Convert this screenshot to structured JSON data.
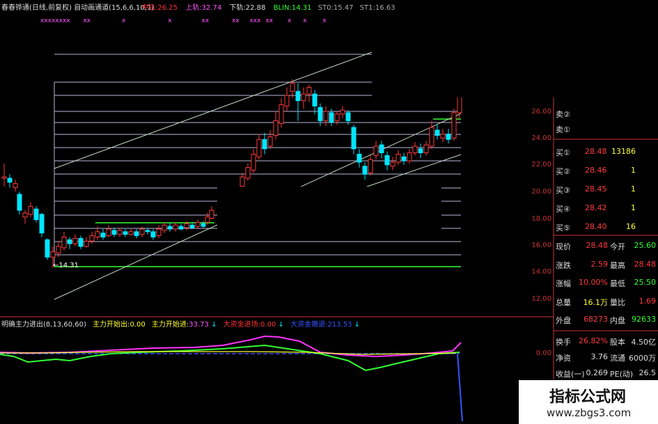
{
  "header": {
    "title": "春春铧通(日线,前复权)",
    "indicator": "自动画通道(15,6,6,10,1)",
    "mid_label": "中轨:",
    "mid_value": "26.25",
    "upper_label": "上轨:",
    "upper_value": "32.74",
    "lower_label": "下轨:",
    "lower_value": "22.88",
    "blin_label": "BLIN:",
    "blin_value": "14.31",
    "st0_label": "ST0:",
    "st0_value": "15.47",
    "st1_label": "ST1:",
    "st1_value": "16.63"
  },
  "marker_x": "x",
  "marker_xs": "xx",
  "marker_xxx": "xxx",
  "marker_row": "xxxxxxxx",
  "low_label": "←14.31",
  "sub": {
    "title": "明确主力进出(8,13,60,60)",
    "l1_label": "主力开始出:",
    "l1_value": "0.00",
    "l2_label": "主力开始进:",
    "l2_value": "33.73",
    "l3_label": "大资金进场:",
    "l3_value": "0.00",
    "l4_label": "大资金撤退:",
    "l4_value": "213.53",
    "arrow": "↓",
    "axis_zero": "0.00"
  },
  "price_axis": [
    "26.00",
    "24.00",
    "22.00",
    "20.00",
    "18.00",
    "16.00",
    "14.00",
    "12.00"
  ],
  "quote": {
    "sell": [
      {
        "label": "卖②"
      },
      {
        "label": "卖①"
      }
    ],
    "buy": [
      {
        "label": "买①",
        "price": "28.48",
        "vol": "13186"
      },
      {
        "label": "买②",
        "price": "28.46",
        "vol": "1"
      },
      {
        "label": "买③",
        "price": "28.45",
        "vol": "1"
      },
      {
        "label": "买④",
        "price": "28.42",
        "vol": "1"
      },
      {
        "label": "买⑤",
        "price": "28.40",
        "vol": "16"
      }
    ],
    "stats": [
      {
        "l1": "现价",
        "v1": "28.48",
        "l2": "今开",
        "v2": "25.60"
      },
      {
        "l1": "涨跌",
        "v1": "2.59",
        "l2": "最高",
        "v2": "28.48"
      },
      {
        "l1": "涨幅",
        "v1": "10.00%",
        "l2": "最低",
        "v2": "25.50"
      },
      {
        "l1": "总量",
        "v1": "16.1万",
        "l2": "量比",
        "v2": "1.69"
      },
      {
        "l1": "外盘",
        "v1": "68273",
        "l2": "内盘",
        "v2": "92633"
      }
    ],
    "stats2": [
      {
        "l1": "换手",
        "v1": "26.82%",
        "l2": "股本",
        "v2": "4.50亿"
      },
      {
        "l1": "净资",
        "v1": "3.76",
        "l2": "流通",
        "v2": "6000万"
      },
      {
        "l1": "收益(一)",
        "v1": "0.269",
        "l2": "PE(动)",
        "v2": "26.5"
      }
    ]
  },
  "watermark": {
    "cn": "指标公式网",
    "url": "www.zbgs3.com"
  },
  "colors": {
    "up": "#ff3a3a",
    "down": "#00e5ff",
    "grid": "#b9b9dc",
    "channel": "#c0d8c0",
    "green": "#33ff33",
    "magenta": "#ff33ff",
    "yellow": "#ffff33"
  }
}
